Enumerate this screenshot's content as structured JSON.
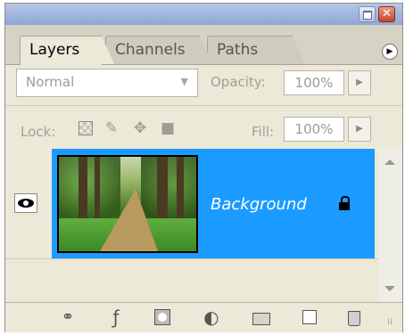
{
  "window": {
    "minimize_icon": "minimize-icon",
    "close_icon": "close-icon",
    "close_glyph": "✕"
  },
  "tabs": [
    {
      "label": "Layers",
      "active": true
    },
    {
      "label": "Channels",
      "active": false
    },
    {
      "label": "Paths",
      "active": false
    }
  ],
  "panel_menu_glyph": "▶",
  "blend": {
    "mode": "Normal",
    "opacity_label": "Opacity:",
    "opacity_value": "100%"
  },
  "lock": {
    "label": "Lock:",
    "fill_label": "Fill:",
    "fill_value": "100%"
  },
  "layers": [
    {
      "name": "Background",
      "visible": true,
      "locked": true,
      "selected": true
    }
  ],
  "colors": {
    "selection": "#1b9bff",
    "panel_bg": "#ece9d8"
  },
  "footer_icons": [
    "link-layers-icon",
    "layer-style-icon",
    "layer-mask-icon",
    "adjustment-layer-icon",
    "group-folder-icon",
    "new-layer-icon",
    "delete-layer-icon"
  ]
}
